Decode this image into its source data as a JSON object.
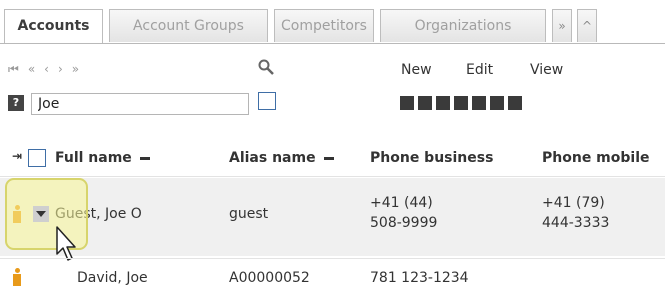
{
  "tabs": [
    {
      "label": "Accounts",
      "active": true
    },
    {
      "label": "Account Groups",
      "active": false
    },
    {
      "label": "Competitors",
      "active": false
    },
    {
      "label": "Organizations",
      "active": false
    },
    {
      "label": "»",
      "active": false
    },
    {
      "label": "^",
      "active": false
    }
  ],
  "toolbar": {
    "nav_icons": [
      "first-page-icon",
      "previous-set-icon",
      "previous-icon",
      "next-icon",
      "next-set-icon"
    ],
    "new_label": "New",
    "edit_label": "Edit",
    "view_label": "View"
  },
  "search": {
    "value": "Joe"
  },
  "grid": {
    "columns": [
      "Full name",
      "Alias name",
      "Phone business",
      "Phone mobile"
    ],
    "rows": [
      {
        "full_name": "Guest, Joe O",
        "alias": "guest",
        "phone_business": [
          "+41 (44)",
          "508-9999"
        ],
        "phone_mobile": [
          "+41 (79)",
          "444-3333"
        ]
      },
      {
        "full_name": "David, Joe",
        "alias": "A00000052",
        "phone_business": [
          "781 123-1234"
        ],
        "phone_mobile": [
          ""
        ]
      }
    ]
  },
  "colors": {
    "accent": "#3f6ea6",
    "person_icon": "#e89a1a",
    "highlight": "#f8f696"
  }
}
